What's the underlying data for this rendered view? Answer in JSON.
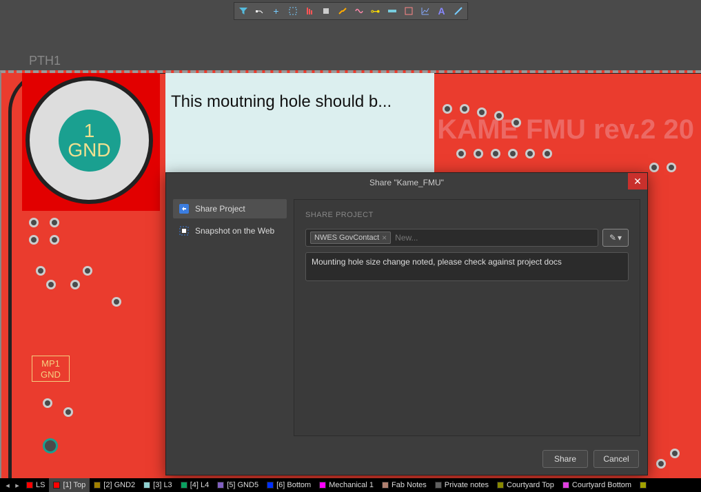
{
  "toolbar_icons": [
    "filter",
    "path",
    "cross",
    "select",
    "bars",
    "chip",
    "trace",
    "wave",
    "key",
    "ruler",
    "box",
    "graph",
    "text",
    "line"
  ],
  "pcb": {
    "designator": "PTH1",
    "pad_number": "1",
    "pad_net": "GND",
    "board_text": "KAME FMU rev.2 20",
    "note_text": "This moutning hole should b...",
    "mp1_ref": "MP1",
    "mp1_net": "GND"
  },
  "modal": {
    "title": "Share \"Kame_FMU\"",
    "side": {
      "share_project": "Share Project",
      "snapshot": "Snapshot on the Web"
    },
    "section_label": "SHARE PROJECT",
    "chip": "NWES GovContact",
    "input_placeholder": "New...",
    "message": "Mounting hole size change noted, please check against project docs",
    "share_btn": "Share",
    "cancel_btn": "Cancel"
  },
  "layers": {
    "ls": "LS",
    "items": [
      {
        "color": "#ff0000",
        "label": "[1] Top",
        "active": true
      },
      {
        "color": "#a08000",
        "label": "[2] GND2"
      },
      {
        "color": "#8fd0d0",
        "label": "[3] L3"
      },
      {
        "color": "#0aa060",
        "label": "[4] L4"
      },
      {
        "color": "#8060c0",
        "label": "[5] GND5"
      },
      {
        "color": "#0030ff",
        "label": "[6] Bottom"
      },
      {
        "color": "#ff00ff",
        "label": "Mechanical 1"
      },
      {
        "color": "#b08070",
        "label": "Fab Notes"
      },
      {
        "color": "#606060",
        "label": "Private notes"
      },
      {
        "color": "#888800",
        "label": "Courtyard Top"
      },
      {
        "color": "#e040e0",
        "label": "Courtyard Bottom"
      }
    ]
  }
}
